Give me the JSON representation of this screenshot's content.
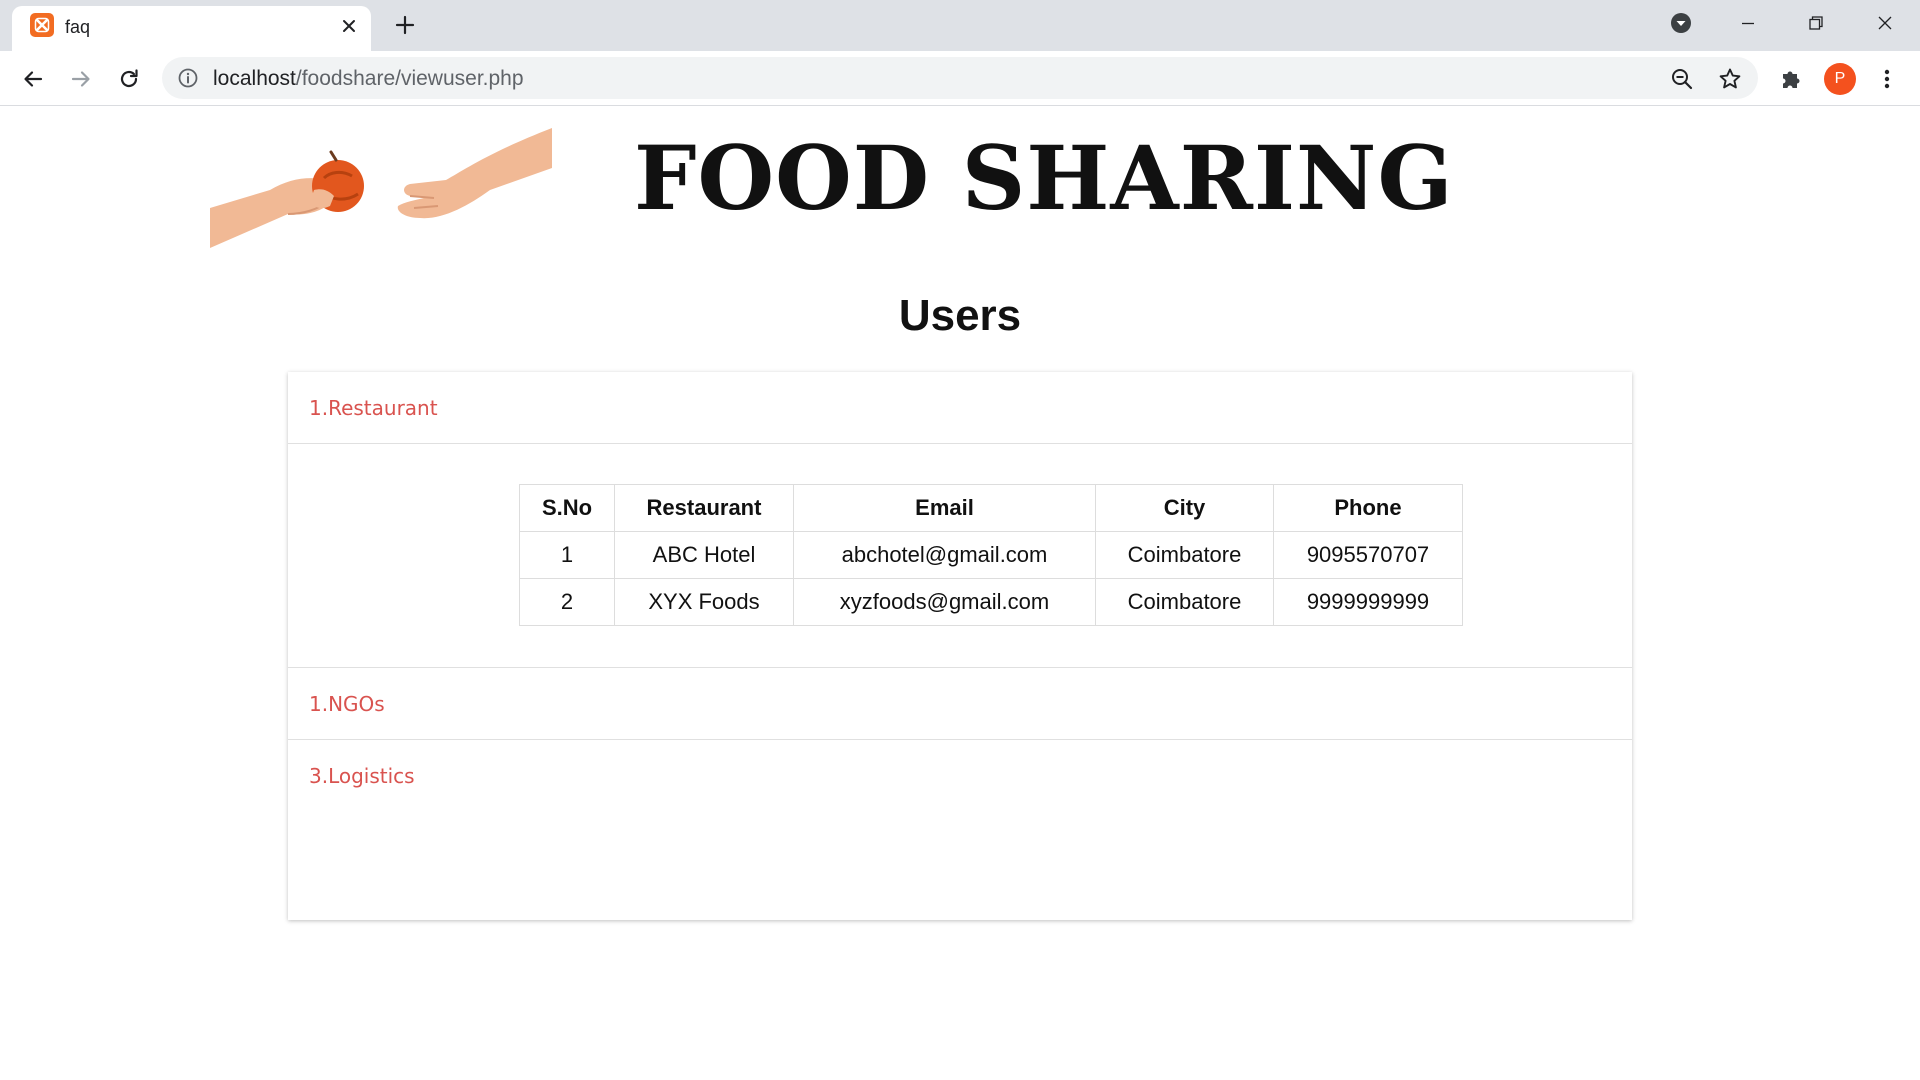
{
  "browser": {
    "tab_title": "faq",
    "url_host": "localhost",
    "url_path": "/foodshare/viewuser.php",
    "profile_initial": "P",
    "accent_color": "#f4511e"
  },
  "icons": {
    "favicon": "xampp-icon",
    "tab_close": "close-icon",
    "new_tab": "plus-icon",
    "tab_search": "chevron-down-icon",
    "back": "arrow-left-icon",
    "forward": "arrow-right-icon",
    "reload": "reload-icon",
    "site_info": "info-icon",
    "zoom": "zoom-out-icon",
    "bookmark": "star-icon",
    "extensions": "puzzle-icon",
    "menu": "kebab-menu-icon"
  },
  "page": {
    "site_title": "FOOD SHARING",
    "heading": "Users"
  },
  "sections": [
    {
      "label": "1.Restaurant",
      "expanded": true,
      "table": {
        "headers": [
          "S.No",
          "Restaurant",
          "Email",
          "City",
          "Phone"
        ],
        "rows": [
          [
            "1",
            "ABC Hotel",
            "abchotel@gmail.com",
            "Coimbatore",
            "9095570707"
          ],
          [
            "2",
            "XYX Foods",
            "xyzfoods@gmail.com",
            "Coimbatore",
            "9999999999"
          ]
        ]
      }
    },
    {
      "label": "1.NGOs",
      "expanded": false
    },
    {
      "label": "3.Logistics",
      "expanded": false
    }
  ],
  "colors": {
    "section_label": "#d9534f",
    "title": "#111111"
  }
}
